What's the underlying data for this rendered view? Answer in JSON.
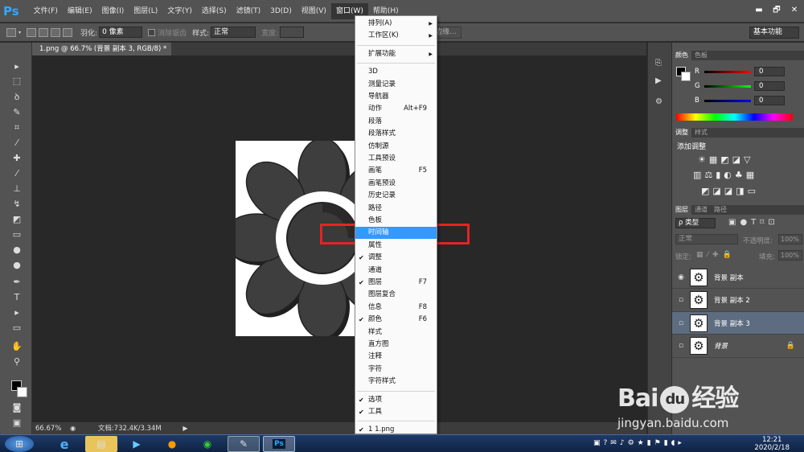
{
  "app": {
    "logo": "Ps"
  },
  "menubar": {
    "items": [
      "文件(F)",
      "编辑(E)",
      "图像(I)",
      "图层(L)",
      "文字(Y)",
      "选择(S)",
      "滤镜(T)",
      "3D(D)",
      "视图(V)",
      "窗口(W)",
      "帮助(H)"
    ],
    "active_index": 9
  },
  "window_controls": {
    "minimize": "▬",
    "restore": "🗗",
    "close": "✕"
  },
  "options": {
    "feather_label": "羽化:",
    "feather_value": "0 像素",
    "antialias_label": "消除锯齿",
    "style_label": "样式:",
    "style_value": "正常",
    "width_label": "宽度:",
    "refine_edge": "调整边缘...",
    "workspace": "基本功能"
  },
  "document": {
    "tab_title": "1.png @ 66.7% (背景 副本 3, RGB/8) *",
    "tab_close": "×"
  },
  "status": {
    "zoom": "66.67%",
    "doc_size": "文档:732.4K/3.34M"
  },
  "window_menu": {
    "items": [
      {
        "label": "排列(A)",
        "submenu": true
      },
      {
        "label": "工作区(K)",
        "submenu": true
      },
      {
        "sep": true
      },
      {
        "label": "扩展功能",
        "submenu": true
      },
      {
        "sep": true
      },
      {
        "label": "3D"
      },
      {
        "label": "测量记录"
      },
      {
        "label": "导航器"
      },
      {
        "label": "动作",
        "shortcut": "Alt+F9"
      },
      {
        "label": "段落"
      },
      {
        "label": "段落样式"
      },
      {
        "label": "仿制源"
      },
      {
        "label": "工具预设"
      },
      {
        "label": "画笔",
        "shortcut": "F5"
      },
      {
        "label": "画笔预设"
      },
      {
        "label": "历史记录"
      },
      {
        "label": "路径"
      },
      {
        "label": "色板"
      },
      {
        "label": "时间轴",
        "highlight": true
      },
      {
        "label": "属性"
      },
      {
        "label": "调整",
        "checked": true
      },
      {
        "label": "通道"
      },
      {
        "label": "图层",
        "checked": true,
        "shortcut": "F7"
      },
      {
        "label": "图层复合"
      },
      {
        "label": "信息",
        "shortcut": "F8"
      },
      {
        "label": "颜色",
        "checked": true,
        "shortcut": "F6"
      },
      {
        "label": "样式"
      },
      {
        "label": "直方图"
      },
      {
        "label": "注释"
      },
      {
        "label": "字符"
      },
      {
        "label": "字符样式"
      },
      {
        "sep": true
      },
      {
        "label": "选项",
        "checked": true
      },
      {
        "label": "工具",
        "checked": true
      },
      {
        "sep": true
      },
      {
        "label": "1 1.png",
        "checked": true
      }
    ]
  },
  "color_panel": {
    "tabs": [
      "颜色",
      "色板"
    ],
    "r_label": "R",
    "g_label": "G",
    "b_label": "B",
    "r": "0",
    "g": "0",
    "b": "0"
  },
  "adjust_panel": {
    "tabs": [
      "调整",
      "样式"
    ],
    "title": "添加调整"
  },
  "layers_panel": {
    "tabs": [
      "图层",
      "通道",
      "路径"
    ],
    "kind_label": "ρ 类型",
    "blend_mode": "正常",
    "opacity_label": "不透明度:",
    "opacity": "100%",
    "lock_label": "锁定:",
    "fill_label": "填充:",
    "fill": "100%",
    "layers": [
      {
        "name": "背景 副本",
        "visible": true
      },
      {
        "name": "背景 副本 2",
        "visible": false
      },
      {
        "name": "背景 副本 3",
        "visible": false,
        "selected": true
      },
      {
        "name": "背景",
        "visible": false,
        "locked": true
      }
    ]
  },
  "watermark": {
    "brand": "Bai",
    "brand2": "经验",
    "url": "jingyan.baidu.com"
  },
  "taskbar": {
    "time": "12:21",
    "date": "2020/2/18"
  },
  "colors": {
    "accent": "#31a8ff",
    "highlight": "#3399ff",
    "annotation": "#e32424",
    "panel": "#535353"
  }
}
